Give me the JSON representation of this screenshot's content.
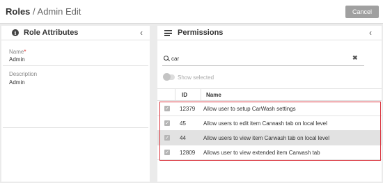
{
  "header": {
    "title_main": "Roles",
    "title_sep": " / ",
    "title_sub": "Admin Edit",
    "cancel_label": "Cancel"
  },
  "left_panel": {
    "title": "Role Attributes",
    "info_icon": "i",
    "collapse_icon": "‹",
    "fields": {
      "name_label": "Name",
      "name_required": "*",
      "name_value": "Admin",
      "description_label": "Description",
      "description_value": "Admin"
    }
  },
  "right_panel": {
    "title": "Permissions",
    "collapse_icon": "‹",
    "search": {
      "value": "car",
      "clear_icon": "✖"
    },
    "toggle_label": "Show selected",
    "table": {
      "headers": {
        "id": "ID",
        "name": "Name"
      },
      "rows": [
        {
          "checked": "✓",
          "id": "12379",
          "name": "Allow user to setup CarWash settings",
          "selected": false
        },
        {
          "checked": "✓",
          "id": "45",
          "name": "Allow users to edit item Carwash tab on local level",
          "selected": false
        },
        {
          "checked": "✓",
          "id": "44",
          "name": "Allow users to view item Carwash tab on local level",
          "selected": true
        },
        {
          "checked": "✓",
          "id": "12809",
          "name": "Allows user to view extended item Carwash tab",
          "selected": false
        }
      ]
    }
  },
  "colors": {
    "highlight_border": "#d9303a",
    "selected_row": "#e2e2e2",
    "cancel_button": "#a0a0a0"
  }
}
